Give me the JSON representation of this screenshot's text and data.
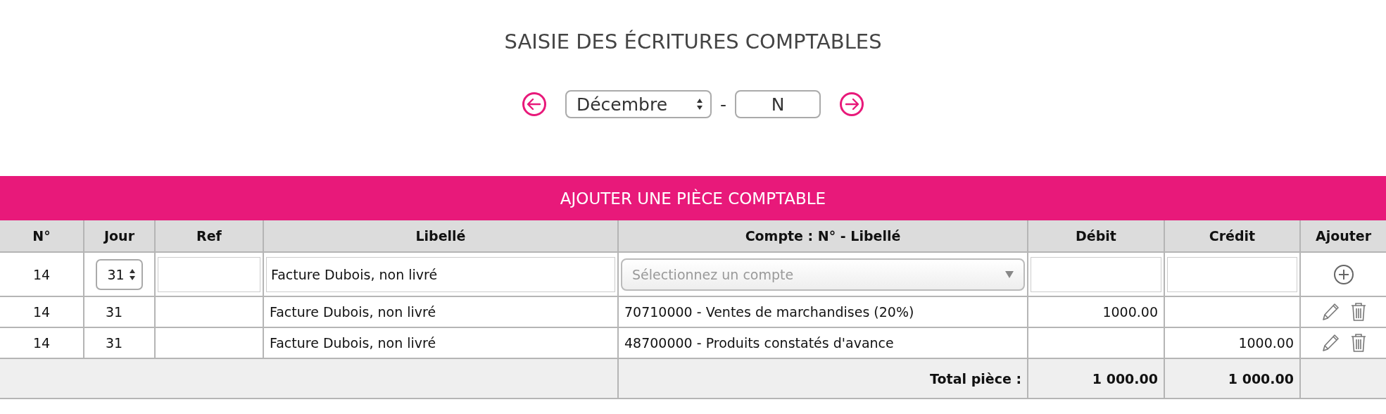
{
  "page_title": "SAISIE DES ÉCRITURES COMPTABLES",
  "period": {
    "month": "Décembre",
    "separator": "-",
    "year": "N"
  },
  "section_title": "AJOUTER UNE PIÈCE COMPTABLE",
  "table": {
    "columns": [
      "N°",
      "Jour",
      "Ref",
      "Libellé",
      "Compte : N° - Libellé",
      "Débit",
      "Crédit",
      "Ajouter"
    ],
    "entry_row": {
      "numero": "14",
      "jour": "31",
      "libelle": "Facture Dubois, non livré",
      "compte_placeholder": "Sélectionnez un compte"
    },
    "rows": [
      {
        "numero": "14",
        "jour": "31",
        "ref": "",
        "libelle": "Facture Dubois, non livré",
        "compte": "70710000 - Ventes de marchandises (20%)",
        "debit": "1000.00",
        "credit": ""
      },
      {
        "numero": "14",
        "jour": "31",
        "ref": "",
        "libelle": "Facture Dubois, non livré",
        "compte": "48700000 - Produits constatés d'avance",
        "credit": "1000.00",
        "debit": ""
      }
    ],
    "total": {
      "label": "Total pièce :",
      "debit": "1 000.00",
      "credit": "1 000.00"
    }
  }
}
